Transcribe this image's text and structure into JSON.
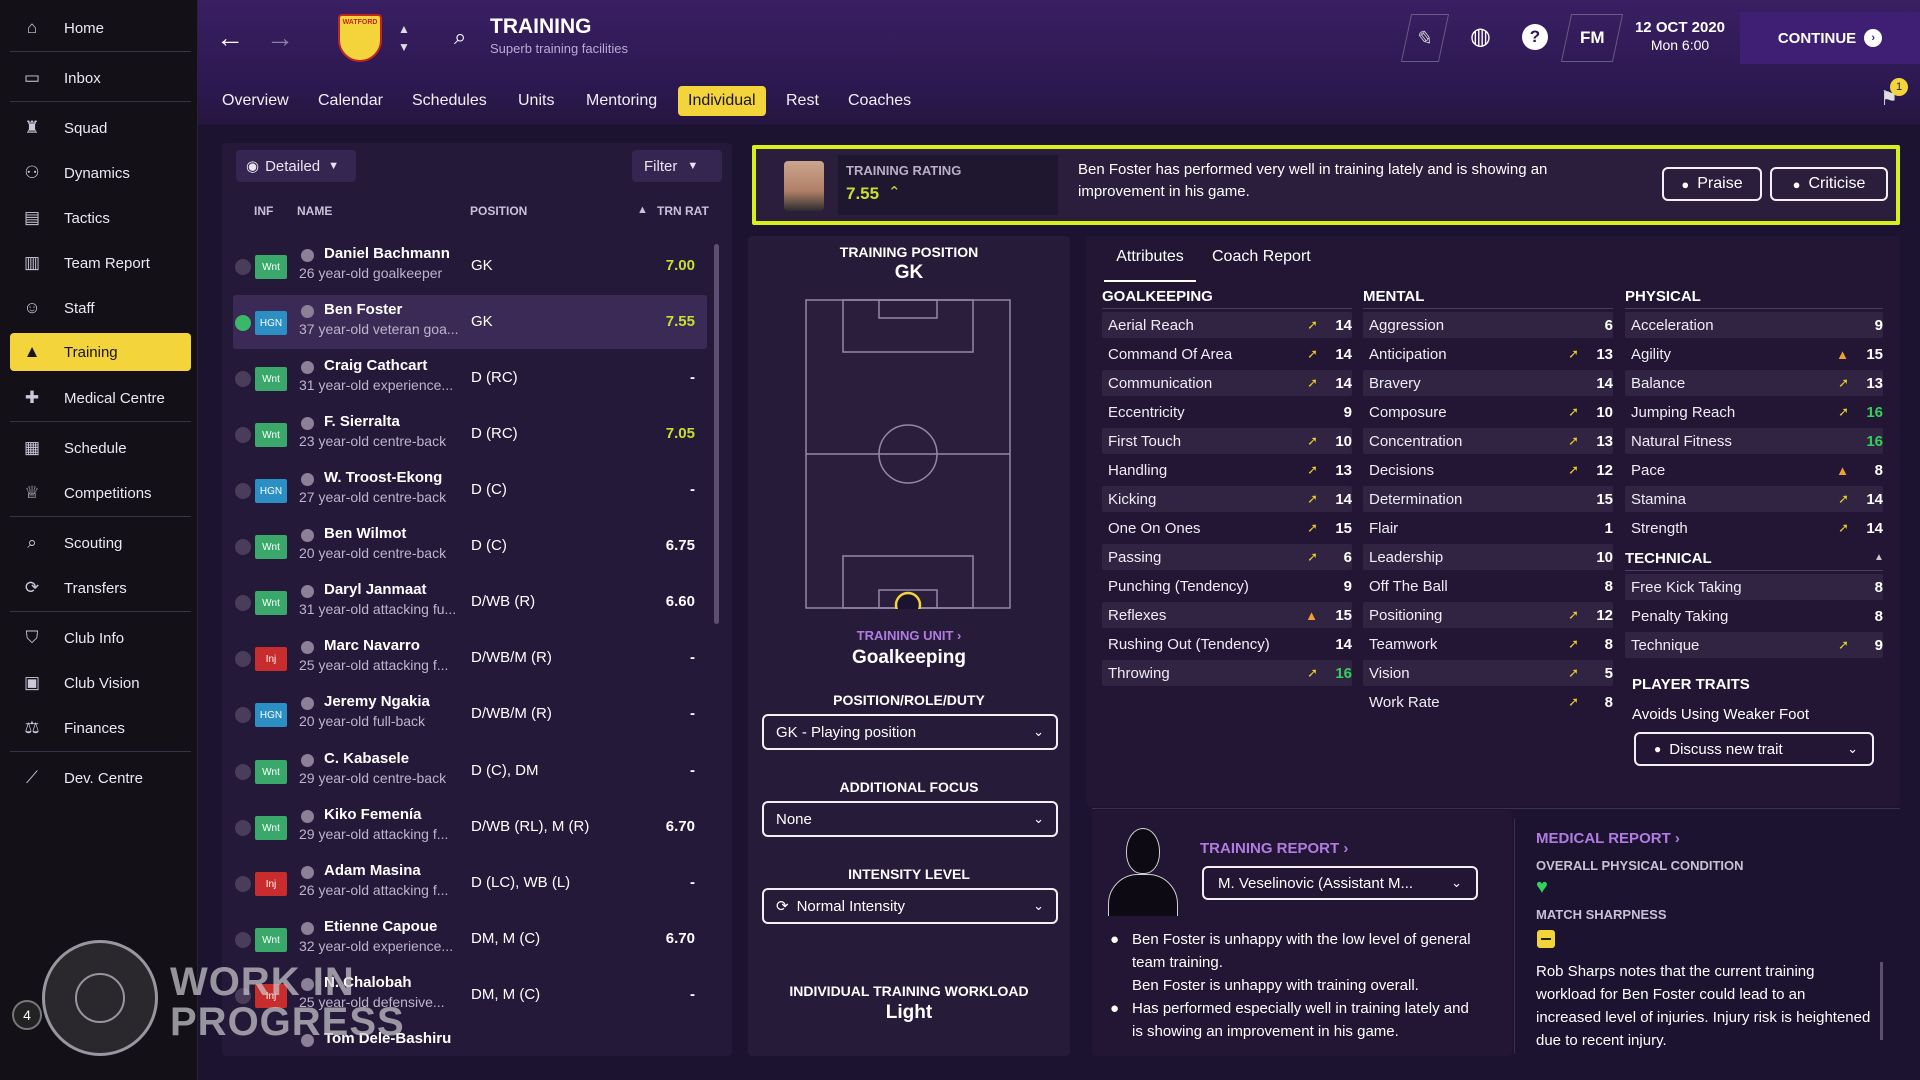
{
  "nav": [
    {
      "label": "Home",
      "icon": "home-icon"
    },
    {
      "label": "Inbox",
      "icon": "inbox-icon"
    },
    {
      "label": "Squad",
      "icon": "squad-icon"
    },
    {
      "label": "Dynamics",
      "icon": "dynamics-icon"
    },
    {
      "label": "Tactics",
      "icon": "tactics-icon"
    },
    {
      "label": "Team Report",
      "icon": "report-icon"
    },
    {
      "label": "Staff",
      "icon": "staff-icon"
    },
    {
      "label": "Training",
      "icon": "training-icon"
    },
    {
      "label": "Medical Centre",
      "icon": "medical-icon"
    },
    {
      "label": "Schedule",
      "icon": "schedule-icon"
    },
    {
      "label": "Competitions",
      "icon": "trophy-icon"
    },
    {
      "label": "Scouting",
      "icon": "search-icon"
    },
    {
      "label": "Transfers",
      "icon": "transfers-icon"
    },
    {
      "label": "Club Info",
      "icon": "shield-icon"
    },
    {
      "label": "Club Vision",
      "icon": "vision-icon"
    },
    {
      "label": "Finances",
      "icon": "finances-icon"
    },
    {
      "label": "Dev. Centre",
      "icon": "dev-icon"
    }
  ],
  "header": {
    "title": "TRAINING",
    "subtitle": "Superb training facilities",
    "club_badge": "WATFORD",
    "date": "12 OCT 2020",
    "time": "Mon 6:00",
    "continue_label": "CONTINUE",
    "fm_label": "FM",
    "help_label": "?",
    "notif_count": "1"
  },
  "tabs": [
    "Overview",
    "Calendar",
    "Schedules",
    "Units",
    "Mentoring",
    "Individual",
    "Rest",
    "Coaches"
  ],
  "list": {
    "view_label": "Detailed",
    "filter_label": "Filter",
    "cols": [
      "INF",
      "NAME",
      "POSITION",
      "TRN RAT"
    ],
    "players": [
      {
        "badge": "Wnt",
        "name": "Daniel Bachmann",
        "desc": "26 year-old goalkeeper",
        "pos": "GK",
        "rat": "7.00"
      },
      {
        "badge": "HGN",
        "name": "Ben Foster",
        "desc": "37 year-old veteran goa...",
        "pos": "GK",
        "rat": "7.55"
      },
      {
        "badge": "Wnt",
        "name": "Craig Cathcart",
        "desc": "31 year-old experience...",
        "pos": "D (RC)",
        "rat": "-"
      },
      {
        "badge": "Wnt",
        "name": "F. Sierralta",
        "desc": "23 year-old centre-back",
        "pos": "D (RC)",
        "rat": "7.05"
      },
      {
        "badge": "HGN",
        "name": "W. Troost-Ekong",
        "desc": "27 year-old centre-back",
        "pos": "D (C)",
        "rat": "-"
      },
      {
        "badge": "Wnt",
        "name": "Ben Wilmot",
        "desc": "20 year-old centre-back",
        "pos": "D (C)",
        "rat": "6.75"
      },
      {
        "badge": "Wnt",
        "name": "Daryl Janmaat",
        "desc": "31 year-old attacking fu...",
        "pos": "D/WB (R)",
        "rat": "6.60"
      },
      {
        "badge": "Inj",
        "name": "Marc Navarro",
        "desc": "25 year-old attacking f...",
        "pos": "D/WB/M (R)",
        "rat": "-"
      },
      {
        "badge": "HGN",
        "name": "Jeremy Ngakia",
        "desc": "20 year-old full-back",
        "pos": "D/WB/M (R)",
        "rat": "-"
      },
      {
        "badge": "Wnt",
        "name": "C. Kabasele",
        "desc": "29 year-old centre-back",
        "pos": "D (C), DM",
        "rat": "-"
      },
      {
        "badge": "Wnt",
        "name": "Kiko Femenía",
        "desc": "29 year-old attacking f...",
        "pos": "D/WB (RL), M (R)",
        "rat": "6.70"
      },
      {
        "badge": "Inj",
        "name": "Adam Masina",
        "desc": "26 year-old attacking f...",
        "pos": "D (LC), WB (L)",
        "rat": "-"
      },
      {
        "badge": "Wnt",
        "name": "Etienne Capoue",
        "desc": "32 year-old experience...",
        "pos": "DM, M (C)",
        "rat": "6.70"
      },
      {
        "badge": "Inj",
        "name": "N. Chalobah",
        "desc": "25 year-old defensive...",
        "pos": "DM, M (C)",
        "rat": "-"
      },
      {
        "badge": "",
        "name": "Tom Dele-Bashiru",
        "desc": "",
        "pos": "",
        "rat": ""
      }
    ]
  },
  "rating": {
    "label": "TRAINING RATING",
    "value": "7.55",
    "message": "Ben Foster has performed very well in training lately and is showing an improvement in his game.",
    "praise": "Praise",
    "criticise": "Criticise"
  },
  "training": {
    "pos_label": "TRAINING POSITION",
    "pos_value": "GK",
    "unit_label": "TRAINING UNIT",
    "unit_value": "Goalkeeping",
    "prd_label": "POSITION/ROLE/DUTY",
    "prd_value": "GK - Playing position",
    "focus_label": "ADDITIONAL FOCUS",
    "focus_value": "None",
    "intensity_label": "INTENSITY LEVEL",
    "intensity_value": "Normal Intensity",
    "workload_label": "INDIVIDUAL TRAINING WORKLOAD",
    "workload_value": "Light"
  },
  "attr_tabs": [
    "Attributes",
    "Coach Report"
  ],
  "attributes": {
    "goalkeeping_title": "GOALKEEPING",
    "mental_title": "MENTAL",
    "physical_title": "PHYSICAL",
    "technical_title": "TECHNICAL",
    "goalkeeping": [
      {
        "n": "Aerial Reach",
        "v": "14",
        "a": "y"
      },
      {
        "n": "Command Of Area",
        "v": "14",
        "a": "y"
      },
      {
        "n": "Communication",
        "v": "14",
        "a": "y"
      },
      {
        "n": "Eccentricity",
        "v": "9",
        "a": ""
      },
      {
        "n": "First Touch",
        "v": "10",
        "a": "y"
      },
      {
        "n": "Handling",
        "v": "13",
        "a": "y"
      },
      {
        "n": "Kicking",
        "v": "14",
        "a": "y"
      },
      {
        "n": "One On Ones",
        "v": "15",
        "a": "y"
      },
      {
        "n": "Passing",
        "v": "6",
        "a": "y"
      },
      {
        "n": "Punching (Tendency)",
        "v": "9",
        "a": ""
      },
      {
        "n": "Reflexes",
        "v": "15",
        "a": "o"
      },
      {
        "n": "Rushing Out (Tendency)",
        "v": "14",
        "a": ""
      },
      {
        "n": "Throwing",
        "v": "16",
        "a": "y"
      }
    ],
    "mental": [
      {
        "n": "Aggression",
        "v": "6",
        "a": ""
      },
      {
        "n": "Anticipation",
        "v": "13",
        "a": "y"
      },
      {
        "n": "Bravery",
        "v": "14",
        "a": ""
      },
      {
        "n": "Composure",
        "v": "10",
        "a": "y"
      },
      {
        "n": "Concentration",
        "v": "13",
        "a": "y"
      },
      {
        "n": "Decisions",
        "v": "12",
        "a": "y"
      },
      {
        "n": "Determination",
        "v": "15",
        "a": ""
      },
      {
        "n": "Flair",
        "v": "1",
        "a": ""
      },
      {
        "n": "Leadership",
        "v": "10",
        "a": ""
      },
      {
        "n": "Off The Ball",
        "v": "8",
        "a": ""
      },
      {
        "n": "Positioning",
        "v": "12",
        "a": "y"
      },
      {
        "n": "Teamwork",
        "v": "8",
        "a": "y"
      },
      {
        "n": "Vision",
        "v": "5",
        "a": "y"
      },
      {
        "n": "Work Rate",
        "v": "8",
        "a": "y"
      }
    ],
    "physical": [
      {
        "n": "Acceleration",
        "v": "9",
        "a": ""
      },
      {
        "n": "Agility",
        "v": "15",
        "a": "o"
      },
      {
        "n": "Balance",
        "v": "13",
        "a": "y"
      },
      {
        "n": "Jumping Reach",
        "v": "16",
        "a": "y"
      },
      {
        "n": "Natural Fitness",
        "v": "16",
        "a": ""
      },
      {
        "n": "Pace",
        "v": "8",
        "a": "o"
      },
      {
        "n": "Stamina",
        "v": "14",
        "a": "y"
      },
      {
        "n": "Strength",
        "v": "14",
        "a": "y"
      }
    ],
    "technical": [
      {
        "n": "Free Kick Taking",
        "v": "8",
        "a": ""
      },
      {
        "n": "Penalty Taking",
        "v": "8",
        "a": ""
      },
      {
        "n": "Technique",
        "v": "9",
        "a": "y"
      }
    ],
    "traits_title": "PLAYER TRAITS",
    "trait": "Avoids Using Weaker Foot",
    "discuss_label": "Discuss new trait"
  },
  "report": {
    "title": "TRAINING REPORT",
    "coach": "M. Veselinovic (Assistant M...",
    "items": [
      "Ben Foster is unhappy with the low level of general team training.",
      "Ben Foster is unhappy with training overall.",
      "Has performed especially well in training lately and is showing an improvement in his game."
    ]
  },
  "medical": {
    "title": "MEDICAL REPORT",
    "cond_label": "OVERALL PHYSICAL CONDITION",
    "sharp_label": "MATCH SHARPNESS",
    "text": "Rob Sharps notes that the current training workload for Ben Foster could lead to an increased level of injuries. Injury risk is heightened due to recent injury."
  },
  "watermark": {
    "line1": "WORK IN",
    "line2": "PROGRESS",
    "num": "4"
  },
  "colors": {
    "accent": "#f3d43b",
    "purple": "#b07ce0",
    "green": "#35d05b",
    "rating_green": "#c5e033"
  }
}
